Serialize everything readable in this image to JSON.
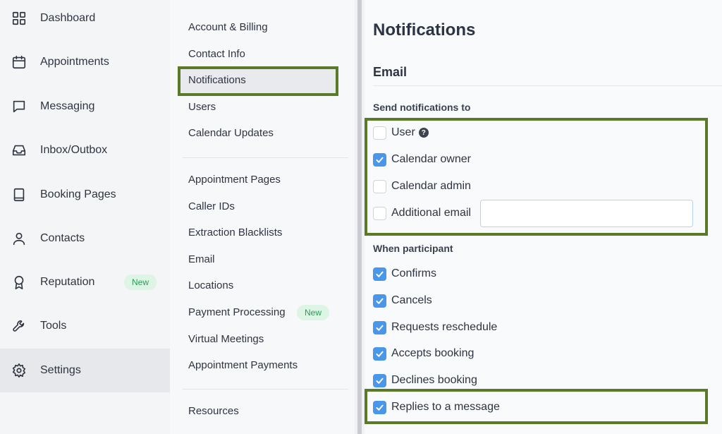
{
  "leftnav": {
    "items": [
      {
        "label": "Dashboard",
        "icon": "grid-icon"
      },
      {
        "label": "Appointments",
        "icon": "calendar-icon"
      },
      {
        "label": "Messaging",
        "icon": "chat-bubble-icon"
      },
      {
        "label": "Inbox/Outbox",
        "icon": "inbox-icon"
      },
      {
        "label": "Booking Pages",
        "icon": "book-icon"
      },
      {
        "label": "Contacts",
        "icon": "person-icon"
      },
      {
        "label": "Reputation",
        "icon": "award-ribbon-icon",
        "badge": "New"
      },
      {
        "label": "Tools",
        "icon": "wrench-icon"
      },
      {
        "label": "Settings",
        "icon": "gear-icon",
        "active": true
      }
    ]
  },
  "settings_nav": {
    "group1": [
      "Account & Billing",
      "Contact Info",
      "Notifications",
      "Users",
      "Calendar Updates"
    ],
    "group2": [
      "Appointment Pages",
      "Caller IDs",
      "Extraction Blacklists",
      "Email",
      "Locations",
      "Payment Processing",
      "Virtual Meetings",
      "Appointment Payments"
    ],
    "group3": [
      "Resources"
    ],
    "payment_badge": "New",
    "active": "Notifications"
  },
  "content": {
    "title": "Notifications",
    "section": "Email",
    "send_to_label": "Send notifications to",
    "send_to": [
      {
        "label": "User",
        "checked": false,
        "help": true
      },
      {
        "label": "Calendar owner",
        "checked": true
      },
      {
        "label": "Calendar admin",
        "checked": false
      },
      {
        "label": "Additional email",
        "checked": false
      }
    ],
    "additional_email_value": "",
    "participant_label": "When participant",
    "participant": [
      {
        "label": "Confirms",
        "checked": true
      },
      {
        "label": "Cancels",
        "checked": true
      },
      {
        "label": "Requests reschedule",
        "checked": true
      },
      {
        "label": "Accepts booking",
        "checked": true
      },
      {
        "label": "Declines booking",
        "checked": true
      },
      {
        "label": "Replies to a message",
        "checked": true
      }
    ],
    "help_glyph": "?"
  },
  "colors": {
    "highlight": "#5a7a2a",
    "checkbox_checked": "#4a96e8",
    "badge_bg": "#dcf5e4",
    "badge_text": "#2d9b55"
  }
}
